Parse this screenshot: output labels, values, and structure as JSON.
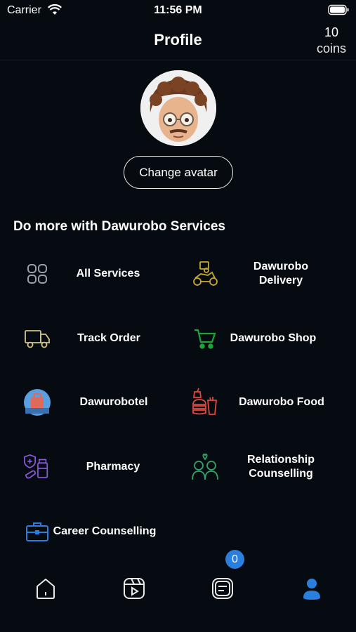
{
  "status_bar": {
    "carrier": "Carrier",
    "time": "11:56 PM"
  },
  "header": {
    "title": "Profile",
    "coins_count": "10",
    "coins_unit": "coins"
  },
  "profile": {
    "change_avatar_label": "Change avatar"
  },
  "services": {
    "section_title": "Do more with Dawurobo Services",
    "items": [
      {
        "label": "All Services",
        "icon": "grid-icon",
        "color": "#9aa0a6"
      },
      {
        "label": "Dawurobo Delivery",
        "icon": "delivery-scooter-icon",
        "color": "#c8a92a"
      },
      {
        "label": "Track Order",
        "icon": "truck-icon",
        "color": "#d4c58a"
      },
      {
        "label": "Dawurobo Shop",
        "icon": "cart-icon",
        "color": "#1ea33a"
      },
      {
        "label": "Dawurobotel",
        "icon": "hotel-suitcase-icon",
        "color": "#5aa0e0"
      },
      {
        "label": "Dawurobo Food",
        "icon": "food-icon",
        "color": "#e0483f"
      },
      {
        "label": "Pharmacy",
        "icon": "pharmacy-icon",
        "color": "#8a5ad8"
      },
      {
        "label": "Relationship Counselling",
        "icon": "couple-icon",
        "color": "#2fa36a"
      },
      {
        "label": "Career Counselling",
        "icon": "briefcase-icon",
        "color": "#2a7fde"
      }
    ]
  },
  "tab_bar": {
    "badge_count": "0",
    "tabs": [
      {
        "icon": "home-icon"
      },
      {
        "icon": "video-icon"
      },
      {
        "icon": "chat-icon"
      },
      {
        "icon": "profile-icon"
      }
    ],
    "active_color": "#2a7fde"
  }
}
